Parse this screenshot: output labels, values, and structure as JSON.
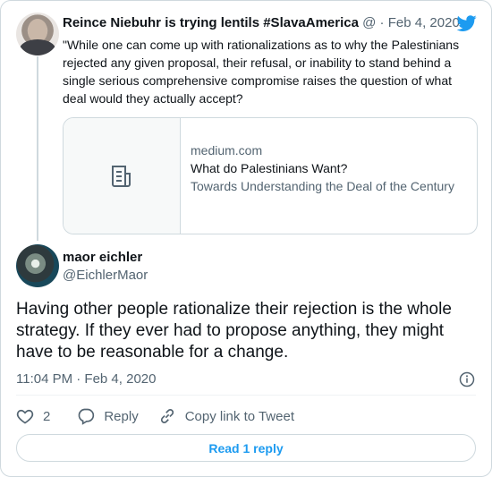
{
  "parent_tweet": {
    "display_name": "Reince Niebuhr is trying lentils #SlavaAmerica",
    "handle": "@",
    "separator": "·",
    "date": "Feb 4, 2020",
    "text": "\"While one can come up with rationalizations as to why the Palestinians rejected any given proposal, their refusal, or inability to stand behind a single serious comprehensive compromise raises the question of what deal would they actually accept?",
    "link_card": {
      "domain": "medium.com",
      "title": "What do Palestinians Want?",
      "description": "Towards Understanding the Deal of the Century",
      "thumb_icon": "article-icon"
    }
  },
  "tweet": {
    "display_name": "maor eichler",
    "handle": "@EichlerMaor",
    "text": "Having other people rationalize their rejection is the whole strategy. If they ever had to propose anything, they might have to be reasonable for a change.",
    "timestamp": "11:04 PM · Feb 4, 2020",
    "actions": {
      "like_count": "2",
      "reply_label": "Reply",
      "copy_link_label": "Copy link to Tweet"
    },
    "read_replies_label": "Read 1 reply"
  },
  "colors": {
    "brand": "#1d9bf0",
    "text": "#0f1419",
    "muted": "#536471",
    "border": "#cfd9de"
  },
  "icons": [
    "twitter-bird-icon",
    "article-icon",
    "info-icon",
    "heart-icon",
    "reply-icon",
    "link-icon"
  ]
}
